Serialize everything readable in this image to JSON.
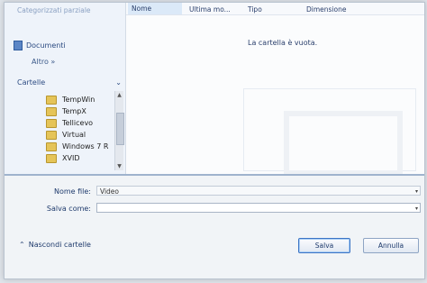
{
  "nav": {
    "header": "Categorizzati parziale",
    "documents": "Documenti",
    "more": "Altro »",
    "section": "Cartelle",
    "folders": [
      {
        "name": "TempWin"
      },
      {
        "name": "TempX"
      },
      {
        "name": "Tellicevo"
      },
      {
        "name": "Virtual"
      },
      {
        "name": "Windows 7 R"
      },
      {
        "name": "XVID"
      }
    ]
  },
  "list": {
    "columns": [
      "Nome",
      "Ultima mo...",
      "Tipo",
      "Dimensione"
    ],
    "empty_message": "La cartella è vuota."
  },
  "form": {
    "filename_label": "Nome file:",
    "filename_value": "Video",
    "savetype_label": "Salva come:",
    "savetype_value": ""
  },
  "footer": {
    "hide_folders": "Nascondi cartelle",
    "save_button": "Salva",
    "cancel_button": "Annulla"
  }
}
